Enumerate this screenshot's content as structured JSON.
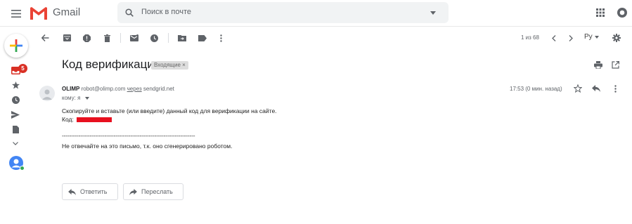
{
  "app": {
    "name": "Gmail"
  },
  "search": {
    "placeholder": "Поиск в почте"
  },
  "toolbar": {
    "pager": "1 из 68",
    "lang": "Ру"
  },
  "nav": {
    "inbox_count": "5"
  },
  "message": {
    "subject": "Код верификации",
    "label": "Входящие ×",
    "sender_name": "OLIMP",
    "sender_email": "robot@olimp.com",
    "via_text": "через",
    "via_domain": "sendgrid.net",
    "to": "кому: я",
    "time": "17:53 (0 мин. назад)",
    "body_line1": "Скопируйте и вставьте (или введите) данный код для верификации на сайте.",
    "code_label": "Код:",
    "separator": "------------------------------------------------------------------------",
    "body_line2": "Не отвечайте на это письмо, т.к. оно сгенерировано роботом."
  },
  "actions": {
    "reply": "Ответить",
    "forward": "Переслать"
  },
  "colors": {
    "gmail_red": "#ea4335",
    "badge_red": "#d93025",
    "icon_gray": "#5f6368"
  }
}
